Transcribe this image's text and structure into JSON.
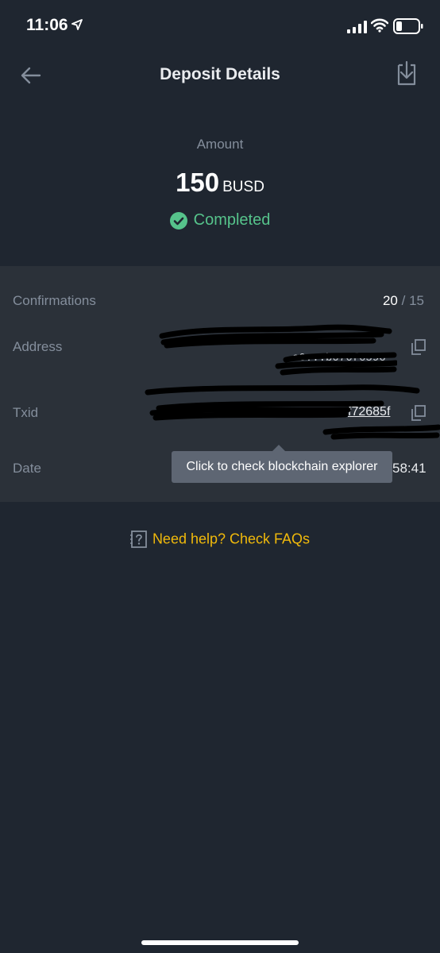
{
  "status_bar": {
    "time": "11:06"
  },
  "header": {
    "title": "Deposit Details"
  },
  "summary": {
    "amount_label": "Amount",
    "amount_value": "150",
    "amount_currency": "BUSD",
    "status": "Completed"
  },
  "details": {
    "confirmations_label": "Confirmations",
    "confirmations_current": "20",
    "confirmations_separator": "/",
    "confirmations_required": "15",
    "address_label": "Address",
    "address_fragment": "e0...b076f6596",
    "txid_label": "Txid",
    "txid_fragment": "f72685f",
    "date_label": "Date",
    "date_value_fragment": "58:41"
  },
  "tooltip": {
    "text": "Click to check blockchain explorer"
  },
  "help": {
    "text": "Need help? Check FAQs"
  },
  "colors": {
    "background": "#1f2630",
    "panel": "#2b3139",
    "success": "#56c38b",
    "accent": "#f0b90b",
    "muted": "#848e9c",
    "tooltip": "#5e6673"
  },
  "icons": [
    "location-arrow-icon",
    "signal-icon",
    "wifi-icon",
    "battery-icon",
    "back-arrow-icon",
    "download-icon",
    "check-circle-icon",
    "copy-icon",
    "help-icon"
  ]
}
